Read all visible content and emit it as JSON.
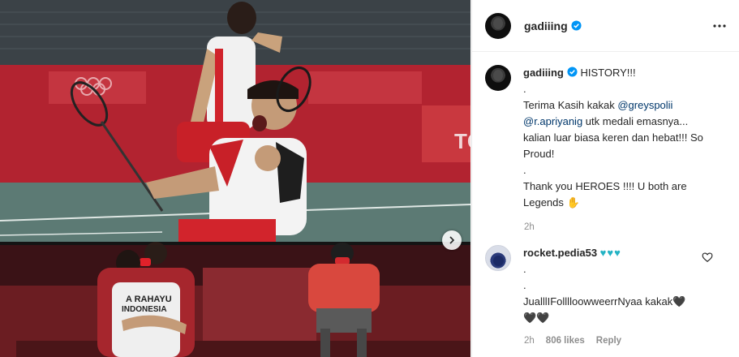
{
  "post": {
    "username": "gadiiing",
    "more_icon": "more-horizontal-icon",
    "verified_icon": "verified-badge-icon"
  },
  "caption": {
    "username": "gadiiing",
    "headline": "HISTORY!!!",
    "line_dot1": ".",
    "thanks_prefix": "Terima Kasih kakak ",
    "mention1": "@greyspolii",
    "mention2": "@r.apriyanig",
    "thanks_rest": " utk medali emasnya... kalian luar biasa keren dan hebat!!! So Proud!",
    "line_dot2": ".",
    "heroes": "Thank you HEROES !!!! U both are Legends ✋",
    "time": "2h"
  },
  "comment": {
    "username": "rocket.pedia53",
    "hearts": "♥♥♥",
    "line1": ".",
    "line2": ".",
    "line3": "JualllIFolllloowweerrNyaa kakak🖤",
    "line4": "🖤🖤",
    "time": "2h",
    "likes": "806 likes",
    "reply": "Reply",
    "like_icon": "heart-outline-icon"
  },
  "media": {
    "next_icon": "chevron-right-icon",
    "jersey_text_1": "A RAHAYU",
    "jersey_text_2": "INDONESIA",
    "sign_text": "TC"
  },
  "colors": {
    "accent_blue": "#0095f6",
    "mention": "#00376b",
    "muted": "#8e8e8e",
    "hearts": "#24b3c4"
  }
}
